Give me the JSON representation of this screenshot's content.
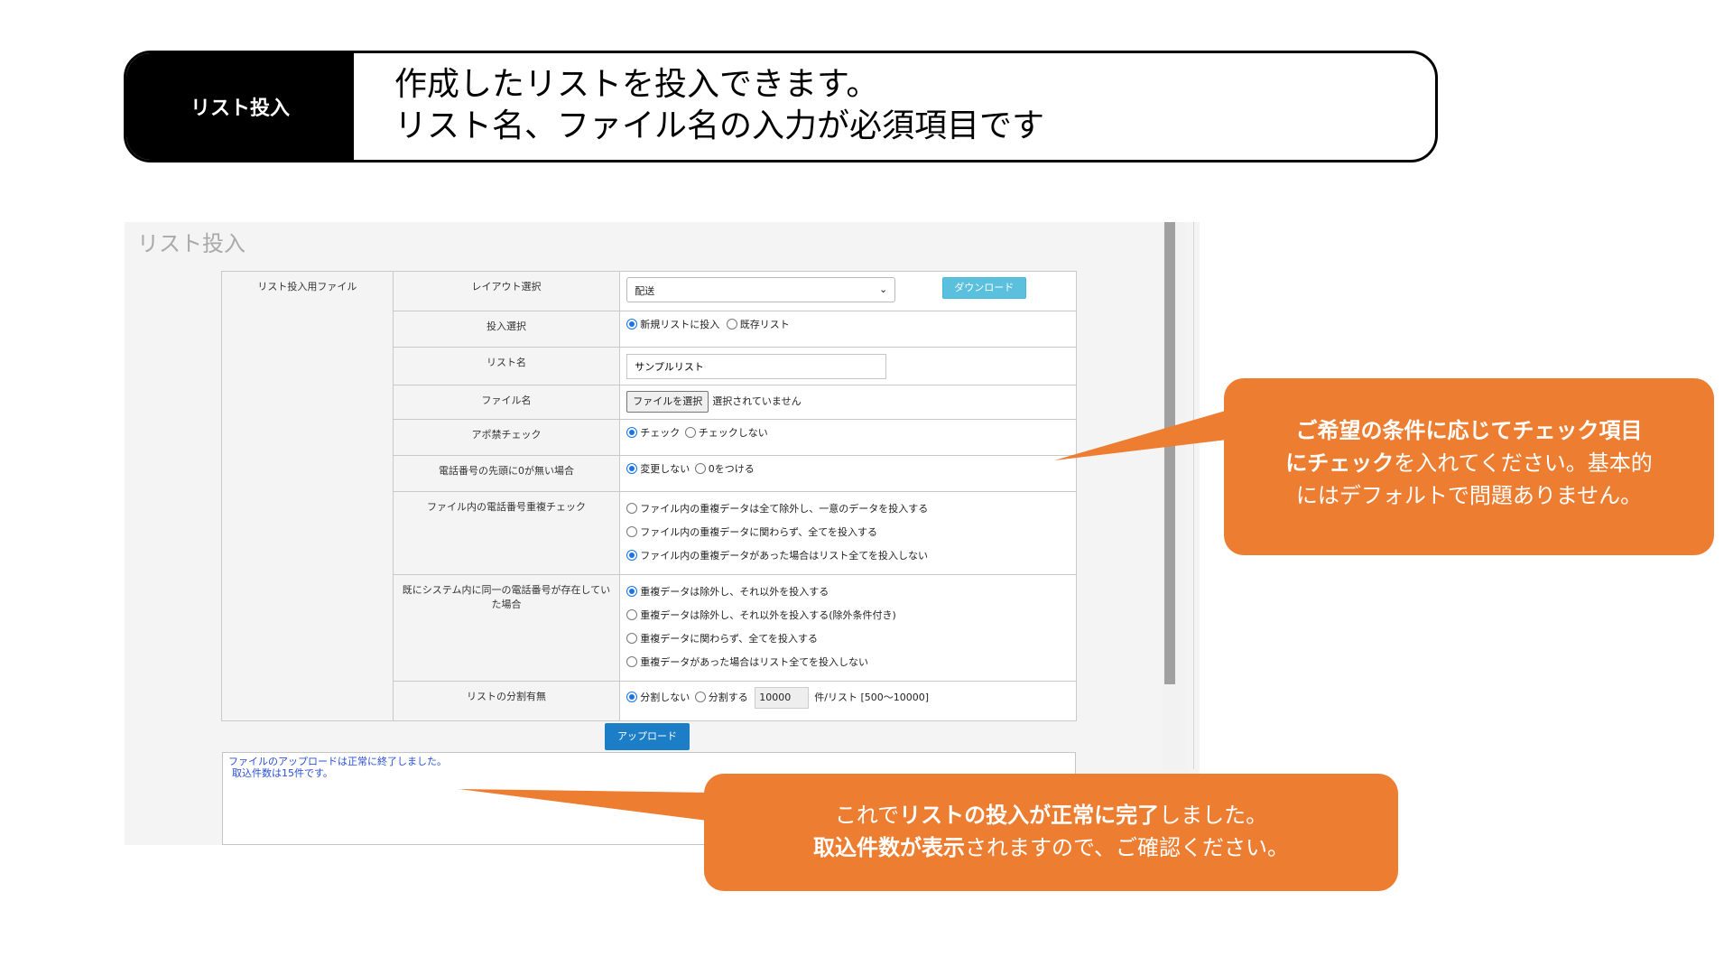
{
  "banner": {
    "tag": "リスト投入",
    "line1": "作成したリストを投入できます。",
    "line2": "リスト名、ファイル名の入力が必須項目です"
  },
  "screen": {
    "title": "リスト投入",
    "section_label": "リスト投入用ファイル",
    "layout": {
      "label": "レイアウト選択",
      "selected": "配送",
      "download_button": "ダウンロード"
    },
    "input_select": {
      "label": "投入選択",
      "options": [
        "新規リストに投入",
        "既存リスト"
      ],
      "selected_index": 0
    },
    "list_name": {
      "label": "リスト名",
      "value": "サンプルリスト"
    },
    "file_name": {
      "label": "ファイル名",
      "choose_button": "ファイルを選択",
      "status": "選択されていません"
    },
    "apo_check": {
      "label": "アポ禁チェック",
      "options": [
        "チェック",
        "チェックしない"
      ],
      "selected_index": 0
    },
    "leading_zero": {
      "label": "電話番号の先頭に0が無い場合",
      "options": [
        "変更しない",
        "0をつける"
      ],
      "selected_index": 0
    },
    "dup_in_file": {
      "label": "ファイル内の電話番号重複チェック",
      "options": [
        "ファイル内の重複データは全て除外し、一意のデータを投入する",
        "ファイル内の重複データに関わらず、全てを投入する",
        "ファイル内の重複データがあった場合はリスト全てを投入しない"
      ],
      "selected_index": 2
    },
    "dup_in_system": {
      "label": "既にシステム内に同一の電話番号が存在していた場合",
      "options": [
        "重複データは除外し、それ以外を投入する",
        "重複データは除外し、それ以外を投入する(除外条件付き)",
        "重複データに関わらず、全てを投入する",
        "重複データがあった場合はリスト全てを投入しない"
      ],
      "selected_index": 0
    },
    "split": {
      "label": "リストの分割有無",
      "option_no": "分割しない",
      "option_yes": "分割する",
      "value": "10000",
      "unit": "件/リスト [500～10000]",
      "selected": "no"
    },
    "upload_button": "アップロード",
    "result_line1": "ファイルのアップロードは正常に終了しました。",
    "result_line2": "取込件数は15件です。"
  },
  "callout1": {
    "bold1": "ご希望の条件に応じてチェック項目",
    "bold2": "にチェック",
    "rest2": "を入れてください。基本的",
    "line3": "にはデフォルトで問題ありません。"
  },
  "callout2": {
    "pre1": "これで",
    "bold1": "リストの投入が正常に完了",
    "post1": "しました。",
    "bold2": "取込件数が表示",
    "post2": "されますので、ご確認ください。"
  },
  "colors": {
    "accent": "#ed7d31",
    "primary_button": "#1c7ec6",
    "info_button": "#5bc0de",
    "result_text": "#2a4fd6"
  }
}
